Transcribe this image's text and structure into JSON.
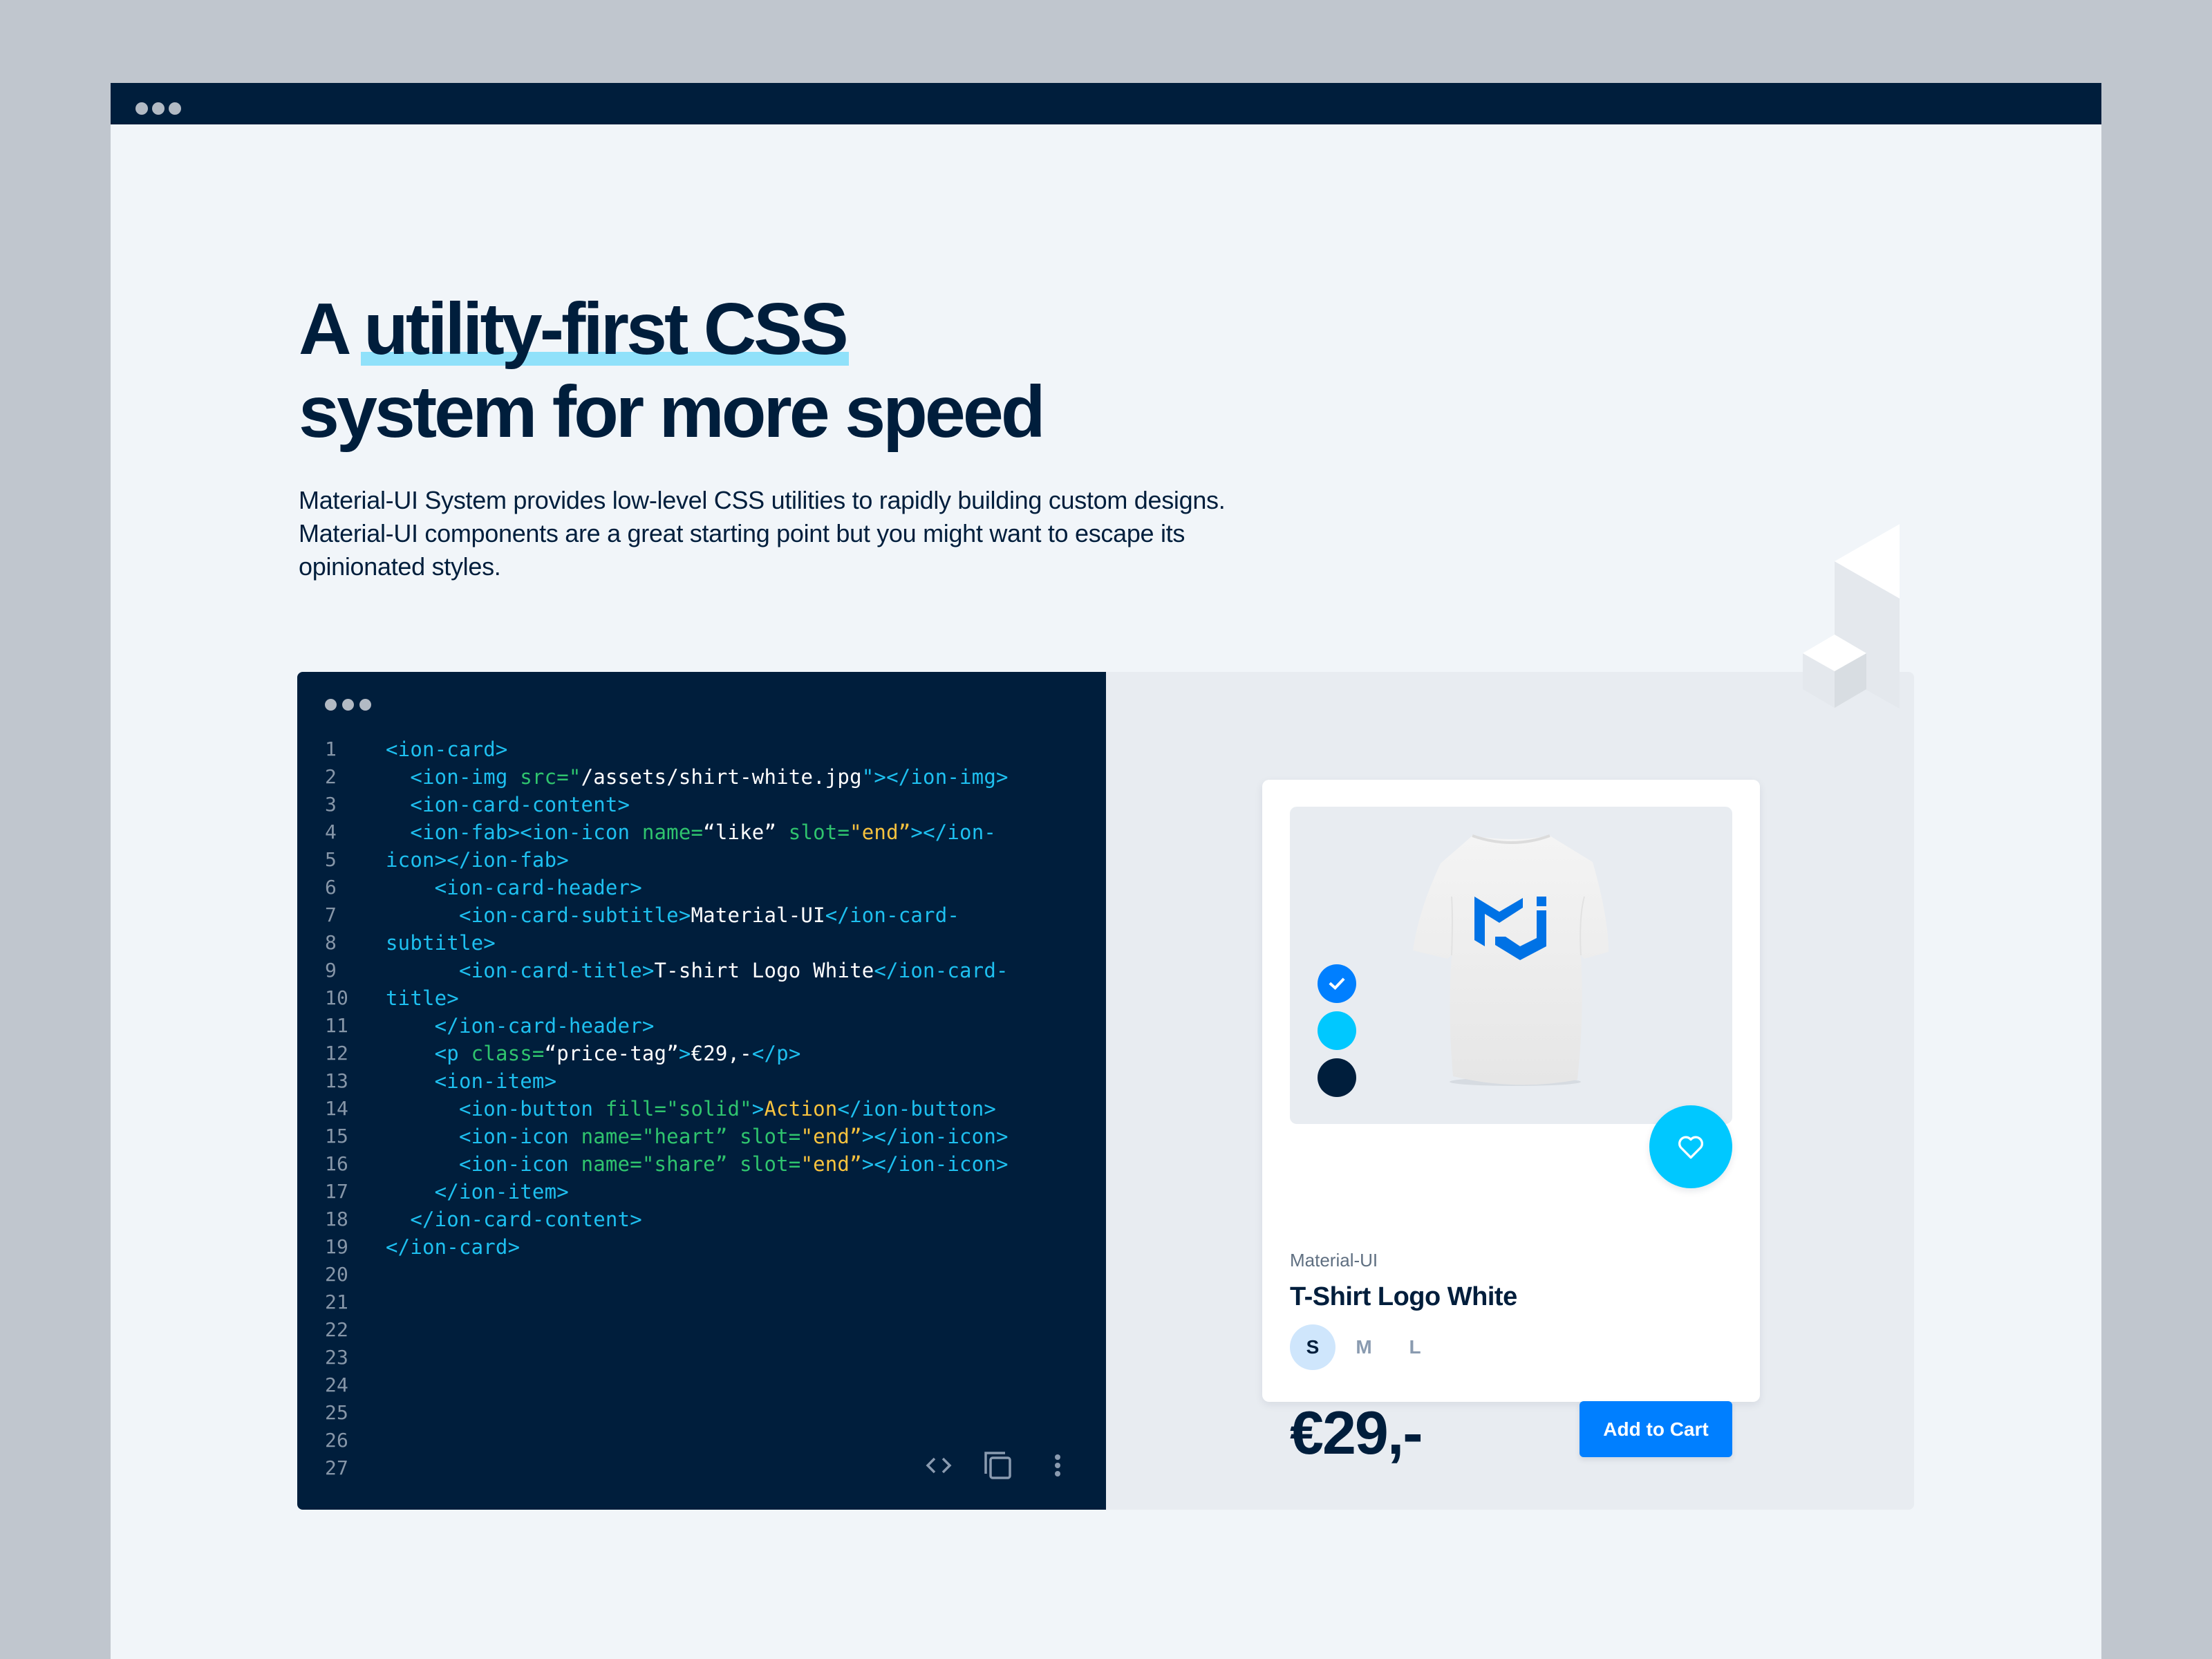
{
  "window": {
    "titlebar_dots": 3
  },
  "hero": {
    "title_prefix": "A ",
    "title_highlight": "utility-first CSS",
    "title_line2": "system for more speed",
    "description": "Material-UI System provides low-level CSS utilities to rapidly building custom designs. Material-UI components are a great starting point but you might want to escape its opinionated styles."
  },
  "code_editor": {
    "lines": [
      {
        "n": "1",
        "tokens": [
          [
            "tag",
            "<ion-card>"
          ]
        ]
      },
      {
        "n": "2",
        "tokens": [
          [
            "tag",
            "  <ion-img "
          ],
          [
            "attr",
            "src=\""
          ],
          [
            "txt",
            "/assets/shirt-white.jpg"
          ],
          [
            "tag",
            "\"></ion-img>"
          ]
        ]
      },
      {
        "n": "3",
        "tokens": [
          [
            "tag",
            "  <ion-card-content>"
          ]
        ]
      },
      {
        "n": "4",
        "tokens": [
          [
            "tag",
            "  <ion-fab><ion-icon "
          ],
          [
            "attr",
            "name="
          ],
          [
            "txt",
            "“like”"
          ],
          [
            "attr",
            " slot="
          ],
          [
            "str",
            "\"end”"
          ],
          [
            "tag",
            "></ion-"
          ]
        ]
      },
      {
        "n": "5",
        "tokens": [
          [
            "tag",
            "icon></ion-fab>"
          ]
        ]
      },
      {
        "n": "6",
        "tokens": [
          [
            "tag",
            "    <ion-card-header>"
          ]
        ]
      },
      {
        "n": "7",
        "tokens": [
          [
            "tag",
            "      <ion-card-subtitle>"
          ],
          [
            "txt",
            "Material-UI"
          ],
          [
            "tag",
            "</ion-card-"
          ]
        ]
      },
      {
        "n": "8",
        "tokens": [
          [
            "tag",
            "subtitle>"
          ]
        ]
      },
      {
        "n": "9",
        "tokens": [
          [
            "tag",
            "      <ion-card-title>"
          ],
          [
            "txt",
            "T-shirt Logo White"
          ],
          [
            "tag",
            "</ion-card-"
          ]
        ]
      },
      {
        "n": "10",
        "tokens": [
          [
            "tag",
            "title>"
          ]
        ]
      },
      {
        "n": "11",
        "tokens": [
          [
            "tag",
            "    </ion-card-header>"
          ]
        ]
      },
      {
        "n": "12",
        "tokens": [
          [
            "tag",
            "    <p "
          ],
          [
            "attr",
            "class="
          ],
          [
            "txt",
            "“price-tag”"
          ],
          [
            "tag",
            ">"
          ],
          [
            "txt",
            "€29,-"
          ],
          [
            "tag",
            "</p>"
          ]
        ]
      },
      {
        "n": "13",
        "tokens": [
          [
            "tag",
            "    <ion-item>"
          ]
        ]
      },
      {
        "n": "14",
        "tokens": [
          [
            "tag",
            "      <ion-button "
          ],
          [
            "attr",
            "fill=\"solid\""
          ],
          [
            "tag",
            ">"
          ],
          [
            "str",
            "Action"
          ],
          [
            "tag",
            "</ion-button>"
          ]
        ]
      },
      {
        "n": "15",
        "tokens": [
          [
            "tag",
            "      <ion-icon "
          ],
          [
            "attr",
            "name=\"heart” slot="
          ],
          [
            "str",
            "\"end”"
          ],
          [
            "tag",
            "></ion-icon>"
          ]
        ]
      },
      {
        "n": "16",
        "tokens": [
          [
            "tag",
            "      <ion-icon "
          ],
          [
            "attr",
            "name=\"share” slot="
          ],
          [
            "str",
            "\"end”"
          ],
          [
            "tag",
            "></ion-icon>"
          ]
        ]
      },
      {
        "n": "17",
        "tokens": [
          [
            "tag",
            "    </ion-item>"
          ]
        ]
      },
      {
        "n": "18",
        "tokens": [
          [
            "tag",
            "  </ion-card-content>"
          ]
        ]
      },
      {
        "n": "19",
        "tokens": [
          [
            "tag",
            "</ion-card>"
          ]
        ]
      },
      {
        "n": "20",
        "tokens": []
      },
      {
        "n": "21",
        "tokens": []
      },
      {
        "n": "22",
        "tokens": []
      },
      {
        "n": "23",
        "tokens": []
      },
      {
        "n": "24",
        "tokens": []
      },
      {
        "n": "25",
        "tokens": []
      },
      {
        "n": "26",
        "tokens": []
      },
      {
        "n": "27",
        "tokens": []
      }
    ],
    "toolbar": [
      {
        "name": "code-icon",
        "label": "View code"
      },
      {
        "name": "copy-icon",
        "label": "Copy"
      },
      {
        "name": "more-vert-icon",
        "label": "More"
      }
    ]
  },
  "product_card": {
    "image_alt": "White t-shirt with Material-UI logo",
    "logo_color": "#0072e5",
    "swatches": [
      {
        "color": "#007fff",
        "selected": true
      },
      {
        "color": "#00c8ff",
        "selected": false
      },
      {
        "color": "#001e3c",
        "selected": false
      }
    ],
    "fab_icon": "heart-outline-icon",
    "subtitle": "Material-UI",
    "title": "T-Shirt Logo White",
    "sizes": [
      {
        "label": "S",
        "selected": true
      },
      {
        "label": "M",
        "selected": false
      },
      {
        "label": "L",
        "selected": false
      }
    ],
    "price": "€29,-",
    "add_to_cart_label": "Add to Cart"
  },
  "colors": {
    "navy": "#001e3c",
    "primary": "#007fff",
    "cyan": "#00c8ff",
    "highlight": "#90e1fa",
    "page_bg": "#f1f5f9",
    "panel_bg": "#e8ecf1"
  }
}
